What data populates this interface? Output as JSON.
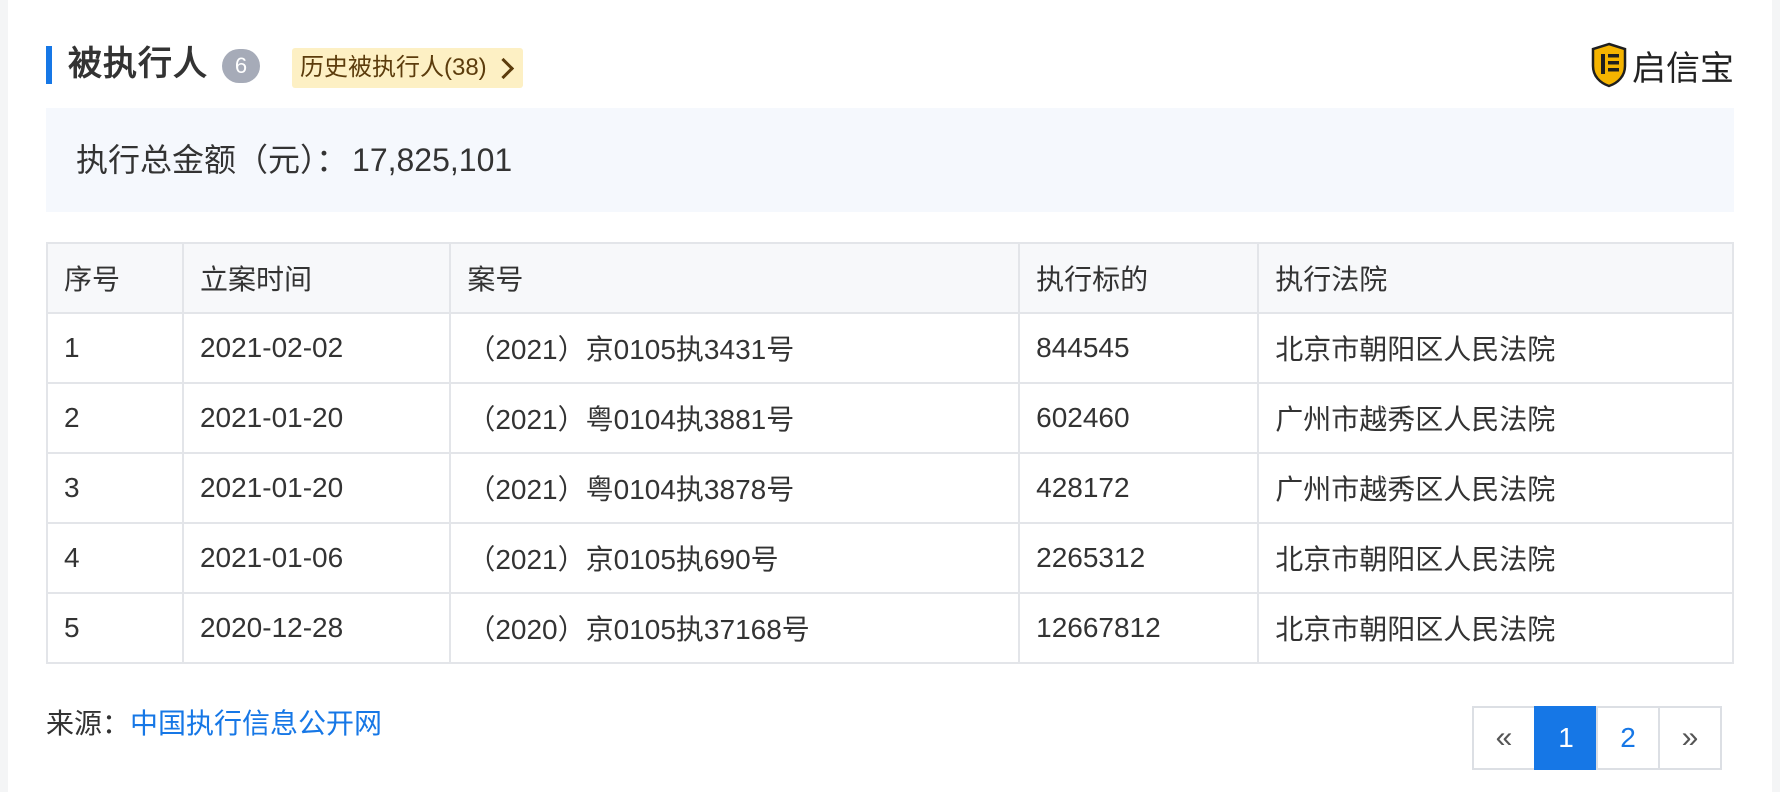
{
  "header": {
    "title": "被执行人",
    "count_badge": "6",
    "history_tag": "历史被执行人(38)",
    "brand_name": "启信宝",
    "brand_icon": "shield-logo-icon",
    "accent_color": "#1677e6"
  },
  "summary": {
    "label": "执行总金额（元）：",
    "amount": "17,825,101"
  },
  "table": {
    "columns": [
      "序号",
      "立案时间",
      "案号",
      "执行标的",
      "执行法院"
    ],
    "rows": [
      [
        "1",
        "2021-02-02",
        "（2021）京0105执3431号",
        "844545",
        "北京市朝阳区人民法院"
      ],
      [
        "2",
        "2021-01-20",
        "（2021）粤0104执3881号",
        "602460",
        "广州市越秀区人民法院"
      ],
      [
        "3",
        "2021-01-20",
        "（2021）粤0104执3878号",
        "428172",
        "广州市越秀区人民法院"
      ],
      [
        "4",
        "2021-01-06",
        "（2021）京0105执690号",
        "2265312",
        "北京市朝阳区人民法院"
      ],
      [
        "5",
        "2020-12-28",
        "（2020）京0105执37168号",
        "12667812",
        "北京市朝阳区人民法院"
      ]
    ]
  },
  "footer": {
    "source_label": "来源：",
    "source_link": "中国执行信息公开网"
  },
  "pagination": {
    "prev": "«",
    "pages": [
      "1",
      "2"
    ],
    "current": "1",
    "next": "»"
  }
}
